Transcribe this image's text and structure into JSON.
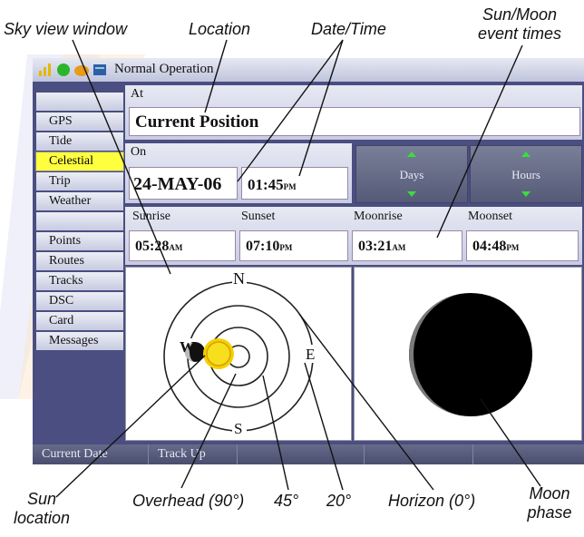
{
  "callouts": {
    "sky_view_window": "Sky view window",
    "location": "Location",
    "date_time": "Date/Time",
    "sun_moon_event_times_1": "Sun/Moon",
    "sun_moon_event_times_2": "event times",
    "sun_location_1": "Sun",
    "sun_location_2": "location",
    "overhead": "Overhead (90°)",
    "deg45": "45°",
    "deg20": "20°",
    "horizon": "Horizon (0°)",
    "moon_phase_1": "Moon",
    "moon_phase_2": "phase"
  },
  "status": {
    "mode": "Normal Operation"
  },
  "sidebar": {
    "items": [
      {
        "label": "GPS"
      },
      {
        "label": "Tide"
      },
      {
        "label": "Celestial"
      },
      {
        "label": "Trip"
      },
      {
        "label": "Weather"
      },
      {
        "label": "Points"
      },
      {
        "label": "Routes"
      },
      {
        "label": "Tracks"
      },
      {
        "label": "DSC"
      },
      {
        "label": "Card"
      },
      {
        "label": "Messages"
      }
    ]
  },
  "location": {
    "label": "At",
    "value": "Current Position"
  },
  "datetime": {
    "label": "On",
    "date": "24-MAY-06",
    "time": "01:45",
    "time_suffix": "PM"
  },
  "buttons": {
    "days": "Days",
    "hours": "Hours"
  },
  "events": [
    {
      "label": "Sunrise",
      "time": "05:28",
      "suffix": "AM"
    },
    {
      "label": "Sunset",
      "time": "07:10",
      "suffix": "PM"
    },
    {
      "label": "Moonrise",
      "time": "03:21",
      "suffix": "AM"
    },
    {
      "label": "Moonset",
      "time": "04:48",
      "suffix": "PM"
    }
  ],
  "compass": {
    "n": "N",
    "s": "S",
    "e": "E",
    "w": "W"
  },
  "bottom": {
    "left": "Current Date",
    "mid": "Track Up"
  },
  "colors": {
    "selected_tab": "#ffff40",
    "sun": "#f7df1e",
    "moon": "#000000",
    "frame": "#4a4e80"
  }
}
